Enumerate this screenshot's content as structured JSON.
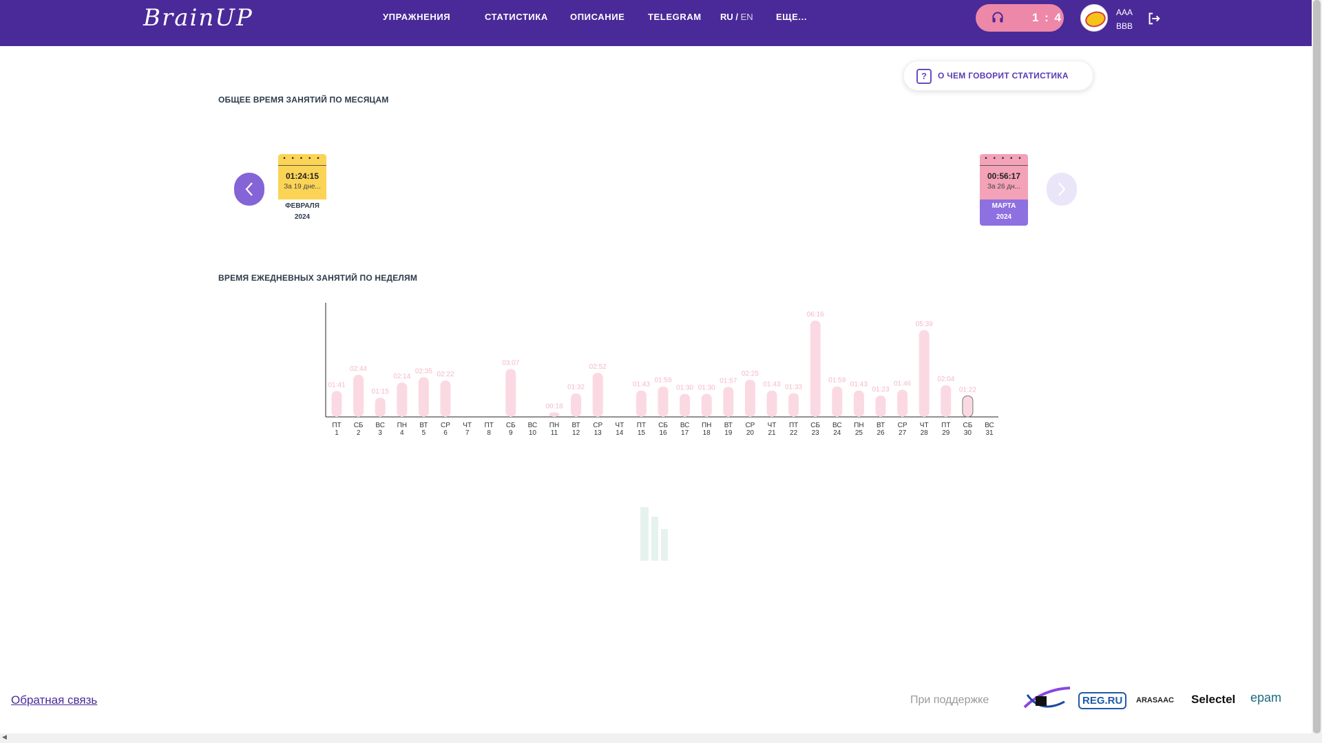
{
  "header": {
    "logo": "BrainUP",
    "nav": [
      "УПРАЖНЕНИЯ",
      "СТАТИСТИКА",
      "ОПИСАНИЕ",
      "TELEGRAM"
    ],
    "lang_ru": "RU",
    "lang_sep": " / ",
    "lang_en": "EN",
    "more": "ЕЩЕ...",
    "audio_pill_text": "1 : 4",
    "user_line1": "AAA",
    "user_line2": "BBB"
  },
  "stats_help_button": "О ЧЕМ ГОВОРИТ СТАТИСТИКА",
  "monthly": {
    "title": "ОБЩЕЕ ВРЕМЯ ЗАНЯТИЙ ПО МЕСЯЦАМ",
    "cards": [
      {
        "time": "01:24:15",
        "days": "За 19 дне...",
        "month": "ФЕВРАЛЯ",
        "year": "2024",
        "color": "#fbd456"
      },
      {
        "time": "00:56:17",
        "days": "За 26 дн...",
        "month": "МАРТА",
        "year": "2024",
        "color": "#f3a2b8"
      }
    ]
  },
  "weekly": {
    "title": "ВРЕМЯ ЕЖЕДНЕВНЫХ ЗАНЯТИЙ ПО НЕДЕЛЯМ"
  },
  "chart_data": {
    "type": "bar",
    "categories": [
      "ПТ 1",
      "СБ 2",
      "ВС 3",
      "ПН 4",
      "ВТ 5",
      "СР 6",
      "ЧТ 7",
      "ПТ 8",
      "СБ 9",
      "ВС 10",
      "ПН 11",
      "ВТ 12",
      "СР 13",
      "ЧТ 14",
      "ПТ 15",
      "СБ 16",
      "ВС 17",
      "ПН 18",
      "ВТ 19",
      "СР 20",
      "ЧТ 21",
      "ПТ 22",
      "СБ 23",
      "ВС 24",
      "ПН 25",
      "ВТ 26",
      "СР 27",
      "ЧТ 28",
      "ПТ 29",
      "СБ 30",
      "ВС 31"
    ],
    "days": [
      {
        "dow": "ПТ",
        "day": "1",
        "label": "01:41",
        "minutes": 101
      },
      {
        "dow": "СБ",
        "day": "2",
        "label": "02:44",
        "minutes": 164
      },
      {
        "dow": "ВС",
        "day": "3",
        "label": "01:15",
        "minutes": 75
      },
      {
        "dow": "ПН",
        "day": "4",
        "label": "02:14",
        "minutes": 134
      },
      {
        "dow": "ВТ",
        "day": "5",
        "label": "02:35",
        "minutes": 155
      },
      {
        "dow": "СР",
        "day": "6",
        "label": "02:22",
        "minutes": 142
      },
      {
        "dow": "ЧТ",
        "day": "7",
        "label": "",
        "minutes": 0
      },
      {
        "dow": "ПТ",
        "day": "8",
        "label": "",
        "minutes": 0
      },
      {
        "dow": "СБ",
        "day": "9",
        "label": "03:07",
        "minutes": 187
      },
      {
        "dow": "ВС",
        "day": "10",
        "label": "",
        "minutes": 0
      },
      {
        "dow": "ПН",
        "day": "11",
        "label": "00:18",
        "minutes": 18
      },
      {
        "dow": "ВТ",
        "day": "12",
        "label": "01:32",
        "minutes": 92
      },
      {
        "dow": "СР",
        "day": "13",
        "label": "02:52",
        "minutes": 172
      },
      {
        "dow": "ЧТ",
        "day": "14",
        "label": "",
        "minutes": 0
      },
      {
        "dow": "ПТ",
        "day": "15",
        "label": "01:43",
        "minutes": 103
      },
      {
        "dow": "СБ",
        "day": "16",
        "label": "01:59",
        "minutes": 119
      },
      {
        "dow": "ВС",
        "day": "17",
        "label": "01:30",
        "minutes": 90
      },
      {
        "dow": "ПН",
        "day": "18",
        "label": "01:30",
        "minutes": 90
      },
      {
        "dow": "ВТ",
        "day": "19",
        "label": "01:57",
        "minutes": 117
      },
      {
        "dow": "СР",
        "day": "20",
        "label": "02:25",
        "minutes": 145
      },
      {
        "dow": "ЧТ",
        "day": "21",
        "label": "01:43",
        "minutes": 103
      },
      {
        "dow": "ПТ",
        "day": "22",
        "label": "01:33",
        "minutes": 93
      },
      {
        "dow": "СБ",
        "day": "23",
        "label": "06:16",
        "minutes": 376
      },
      {
        "dow": "ВС",
        "day": "24",
        "label": "01:59",
        "minutes": 119
      },
      {
        "dow": "ПН",
        "day": "25",
        "label": "01:43",
        "minutes": 103
      },
      {
        "dow": "ВТ",
        "day": "26",
        "label": "01:23",
        "minutes": 83
      },
      {
        "dow": "СР",
        "day": "27",
        "label": "01:46",
        "minutes": 106
      },
      {
        "dow": "ЧТ",
        "day": "28",
        "label": "05:39",
        "minutes": 339
      },
      {
        "dow": "ПТ",
        "day": "29",
        "label": "02:04",
        "minutes": 124
      },
      {
        "dow": "СБ",
        "day": "30",
        "label": "01:22",
        "minutes": 82
      },
      {
        "dow": "ВС",
        "day": "31",
        "label": "",
        "minutes": 0
      }
    ],
    "highlight_index": 29,
    "bar_color": "#fbd9e3",
    "xlabel": "",
    "ylabel": ""
  },
  "footer": {
    "feedback": "Обратная связь",
    "support": "При поддержке",
    "partners": [
      "REG.RU",
      "ARASAAC",
      "Selectel",
      "epam"
    ]
  }
}
